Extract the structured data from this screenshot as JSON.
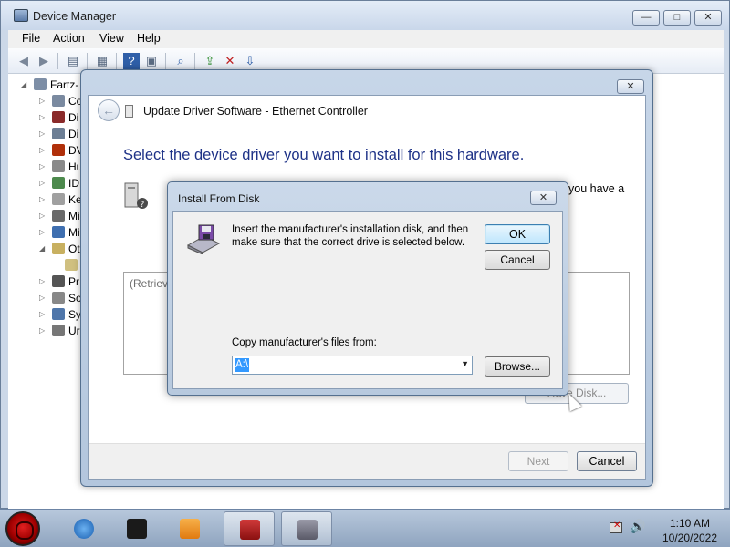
{
  "device_manager": {
    "title": "Device Manager",
    "controls": {
      "minimize": "—",
      "maximize": "□",
      "close": "✕"
    },
    "menu": [
      "File",
      "Action",
      "View",
      "Help"
    ],
    "tree": {
      "root": "Fartz-",
      "items": [
        {
          "label": "Co",
          "icon_color": "#7a8aa0",
          "expand": "▷"
        },
        {
          "label": "Di",
          "icon_color": "#8a2a2a",
          "expand": "▷"
        },
        {
          "label": "Di",
          "icon_color": "#6d7f95",
          "expand": "▷"
        },
        {
          "label": "DV",
          "icon_color": "#b0300a",
          "expand": "▷"
        },
        {
          "label": "Hu",
          "icon_color": "#8a8a8a",
          "expand": "▷"
        },
        {
          "label": "ID",
          "icon_color": "#4d8a4d",
          "expand": "▷"
        },
        {
          "label": "Ke",
          "icon_color": "#a0a0a0",
          "expand": "▷"
        },
        {
          "label": "Mi",
          "icon_color": "#6a6a6a",
          "expand": "▷"
        },
        {
          "label": "Mi",
          "icon_color": "#3f6fb0",
          "expand": "▷"
        },
        {
          "label": "Ot",
          "icon_color": "#c8b060",
          "expand": "◢"
        },
        {
          "label": "",
          "icon_color": "#d0c080",
          "expand": ""
        },
        {
          "label": "Pr",
          "icon_color": "#555555",
          "expand": "▷"
        },
        {
          "label": "So",
          "icon_color": "#888888",
          "expand": "▷"
        },
        {
          "label": "Sy",
          "icon_color": "#4f76aa",
          "expand": "▷"
        },
        {
          "label": "Ur",
          "icon_color": "#777777",
          "expand": "▷"
        }
      ]
    }
  },
  "update_driver": {
    "close": "✕",
    "back": "←",
    "title": "Update Driver Software - Ethernet Controller",
    "heading": "Select the device driver you want to install for this hardware.",
    "text_right": "you have a",
    "list_item": "(Retrievi",
    "have_disk": "Have Disk...",
    "next": "Next",
    "cancel": "Cancel"
  },
  "install_from_disk": {
    "title": "Install From Disk",
    "close": "✕",
    "message": "Insert the manufacturer's installation disk, and then make sure that the correct drive is selected below.",
    "ok": "OK",
    "cancel": "Cancel",
    "copy_label": "Copy manufacturer's files from:",
    "combo_value": "A:\\",
    "combo_arrow": "▼",
    "browse": "Browse..."
  },
  "taskbar": {
    "items": [
      "internet-explorer",
      "media-center",
      "media-player",
      "device-manager-toolbox",
      "install-disk"
    ],
    "clock_time": "1:10 AM",
    "clock_date": "10/20/2022",
    "volume_glyph": "🔊"
  }
}
